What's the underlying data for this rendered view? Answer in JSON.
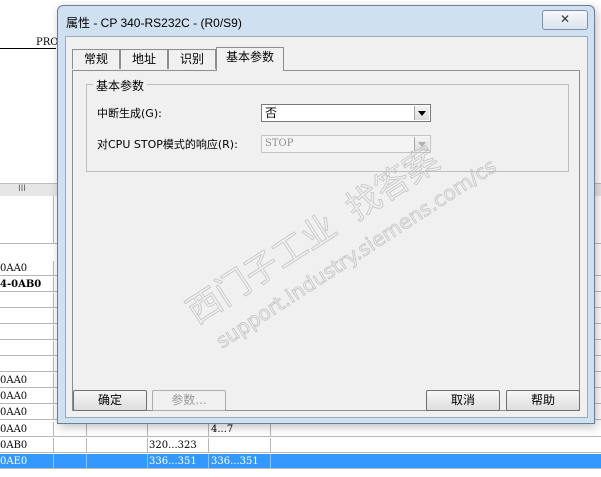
{
  "background": {
    "prof_label": "PROF",
    "splitter_grip": "III",
    "rows": [
      {
        "c0": "0AA0",
        "c1": "",
        "c2": "",
        "c3": ""
      },
      {
        "c0": "4-0AB0",
        "c1": "",
        "c2": "",
        "c3": "",
        "bold": true
      },
      {
        "c0": "",
        "c1": "",
        "c2": "",
        "c3": ""
      },
      {
        "c0": "",
        "c1": "",
        "c2": "",
        "c3": ""
      },
      {
        "c0": "",
        "c1": "",
        "c2": "",
        "c3": ""
      },
      {
        "c0": "",
        "c1": "",
        "c2": "",
        "c3": ""
      },
      {
        "c0": "",
        "c1": "",
        "c2": "",
        "c3": ""
      },
      {
        "c0": "0AA0",
        "c1": "",
        "c2": "",
        "c3": ""
      },
      {
        "c0": "0AA0",
        "c1": "",
        "c2": "",
        "c3": ""
      },
      {
        "c0": "0AA0",
        "c1": "",
        "c2": "",
        "c3": ""
      },
      {
        "c0": "0AA0",
        "c1": "",
        "c2": "",
        "c3": "4...7"
      },
      {
        "c0": "0AB0",
        "c1": "",
        "c2": "320...323",
        "c3": ""
      },
      {
        "c0": "0AE0",
        "c1": "",
        "c2": "336...351",
        "c3": "336...351",
        "selected": true
      }
    ]
  },
  "dialog": {
    "title": "属性 - CP 340-RS232C - (R0/S9)",
    "close_glyph": "✕",
    "tabs": [
      {
        "label": "常规"
      },
      {
        "label": "地址"
      },
      {
        "label": "识别"
      },
      {
        "label": "基本参数",
        "active": true
      }
    ],
    "group_title": "基本参数",
    "fields": {
      "interrupt": {
        "label": "中断生成(G):",
        "value": "否"
      },
      "cpu_stop": {
        "label": "对CPU STOP模式的响应(R):",
        "value": "STOP",
        "disabled": true
      }
    },
    "buttons": {
      "ok": "确定",
      "params": "参数...",
      "cancel": "取消",
      "help": "帮助"
    }
  },
  "watermark": {
    "cn_left": "西门子工业",
    "cn_right": "找答案",
    "url": "support.industry.siemens.com/cs"
  }
}
